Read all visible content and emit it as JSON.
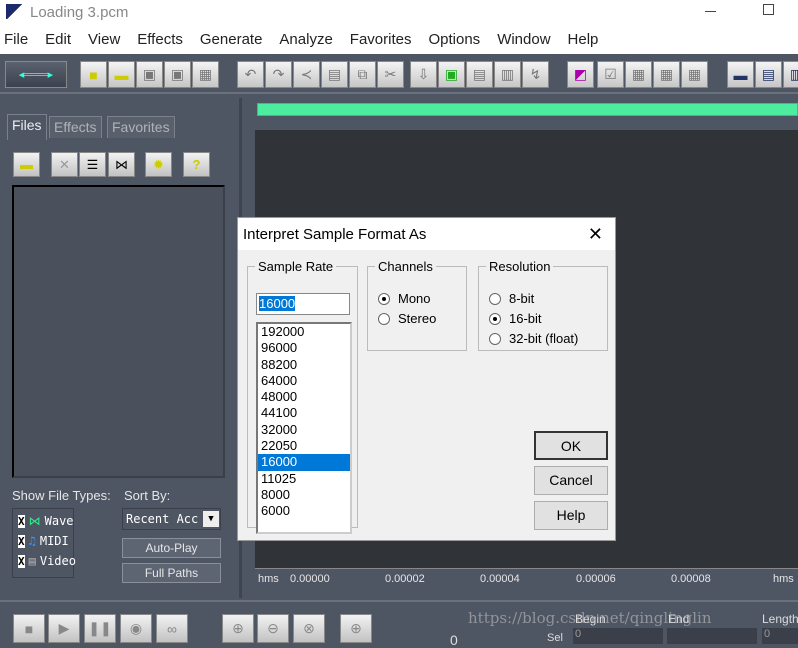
{
  "window": {
    "title": "Loading 3.pcm",
    "minimize_icon": "minimize-icon",
    "maximize_icon": "maximize-icon"
  },
  "menu": [
    "File",
    "Edit",
    "View",
    "Effects",
    "Generate",
    "Analyze",
    "Favorites",
    "Options",
    "Window",
    "Help"
  ],
  "left_panel": {
    "tabs": [
      "Files",
      "Effects",
      "Favorites"
    ],
    "show_file_types_label": "Show File Types:",
    "sort_by_label": "Sort By:",
    "file_types": [
      {
        "label": "Wave",
        "checked": true
      },
      {
        "label": "MIDI",
        "checked": true
      },
      {
        "label": "Video",
        "checked": true
      }
    ],
    "sort_by_value": "Recent Acc",
    "auto_play": "Auto-Play",
    "full_paths": "Full Paths"
  },
  "ruler": {
    "unit": "hms",
    "ticks": [
      "0.00000",
      "0.00002",
      "0.00004",
      "0.00006",
      "0.00008"
    ],
    "unit_right": "hms"
  },
  "status": {
    "begin": "Begin",
    "end": "End",
    "length": "Length",
    "sel": "Sel",
    "sel_begin": "0",
    "sel_length": "0",
    "time": "0"
  },
  "watermark": "https://blog.csdn.net/qinglinglin",
  "dialog": {
    "title": "Interpret Sample Format As",
    "sample_rate": {
      "label": "Sample Rate",
      "value": "16000",
      "options": [
        "192000",
        "96000",
        "88200",
        "64000",
        "48000",
        "44100",
        "32000",
        "22050",
        "16000",
        "11025",
        "8000",
        "6000"
      ],
      "selected": "16000"
    },
    "channels": {
      "label": "Channels",
      "options": [
        "Mono",
        "Stereo"
      ],
      "selected": "Mono"
    },
    "resolution": {
      "label": "Resolution",
      "options": [
        "8-bit",
        "16-bit",
        "32-bit (float)"
      ],
      "selected": "16-bit"
    },
    "ok": "OK",
    "cancel": "Cancel",
    "help": "Help"
  },
  "colors": {
    "progress": "#4ded9f",
    "selection": "#0078d7",
    "app_bg": "#4e5563"
  }
}
